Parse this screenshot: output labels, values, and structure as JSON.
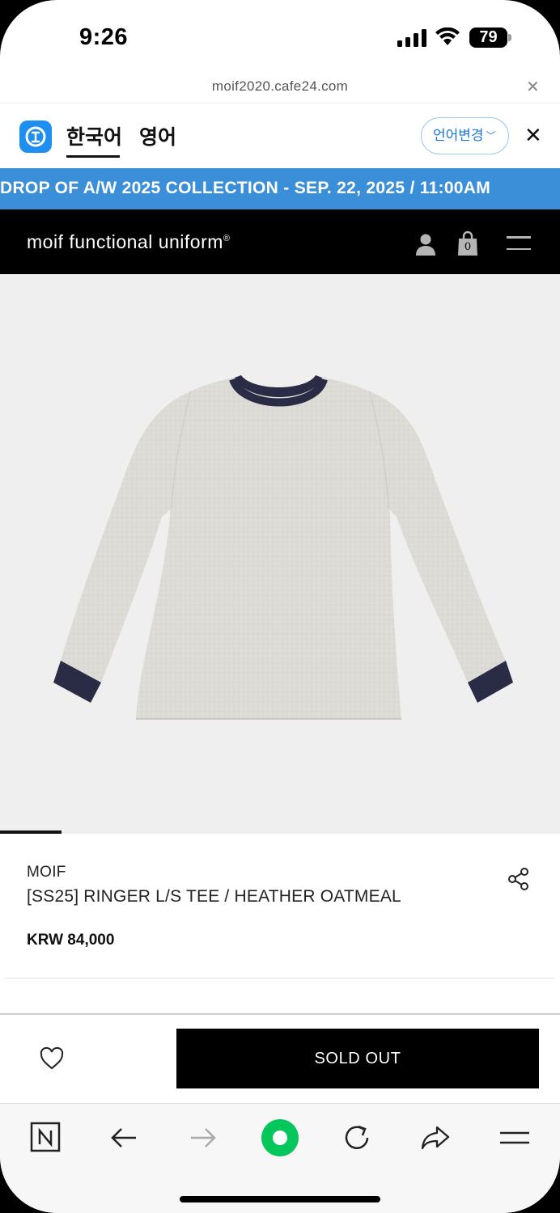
{
  "status_bar": {
    "time": "9:26",
    "battery": "79"
  },
  "browser": {
    "url": "moif2020.cafe24.com"
  },
  "translate_bar": {
    "lang_current": "한국어",
    "lang_other": "영어",
    "change_label": "언어변경"
  },
  "banner": {
    "text": "DROP OF A/W 2025 COLLECTION - SEP. 22, 2025 / 11:00AM"
  },
  "header": {
    "brand": "moif functional uniform",
    "brand_mark": "®",
    "cart_count": "0"
  },
  "product": {
    "brand": "MOIF",
    "name": "[SS25] RINGER L/S TEE / HEATHER OATMEAL",
    "price": "KRW 84,000",
    "status_button": "SOLD OUT"
  },
  "colors": {
    "banner": "#3b8fd9",
    "header": "#000000",
    "accent": "#1a78d6",
    "naver_green": "#03c75a"
  }
}
